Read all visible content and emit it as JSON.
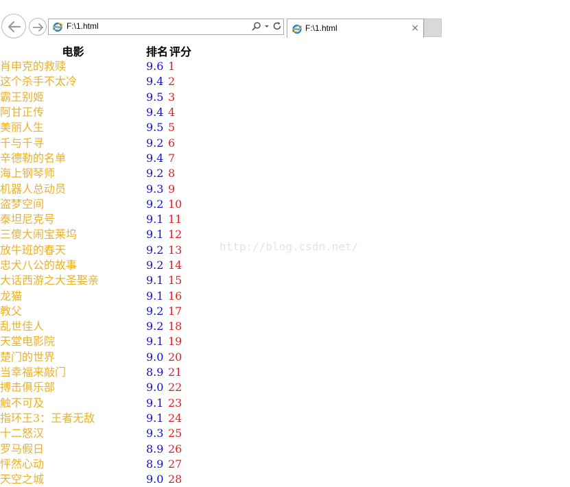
{
  "browser": {
    "address": "F:\\1.html",
    "tab_title": "F:\\1.html",
    "tab_close_glyph": "×",
    "icons": [
      "back-arrow-icon",
      "forward-arrow-icon",
      "ie-icon",
      "search-icon",
      "dropdown-icon",
      "refresh-icon",
      "close-icon"
    ]
  },
  "table": {
    "headers": [
      "电影",
      "排名",
      "评分"
    ],
    "rows": [
      {
        "title": "肖申克的救赎",
        "score": "9.6",
        "rank": "1"
      },
      {
        "title": "这个杀手不太冷",
        "score": "9.4",
        "rank": "2"
      },
      {
        "title": "霸王别姬",
        "score": "9.5",
        "rank": "3"
      },
      {
        "title": "阿甘正传",
        "score": "9.4",
        "rank": "4"
      },
      {
        "title": "美丽人生",
        "score": "9.5",
        "rank": "5"
      },
      {
        "title": "千与千寻",
        "score": "9.2",
        "rank": "6"
      },
      {
        "title": "辛德勒的名单",
        "score": "9.4",
        "rank": "7"
      },
      {
        "title": "海上钢琴师",
        "score": "9.2",
        "rank": "8"
      },
      {
        "title": "机器人总动员",
        "score": "9.3",
        "rank": "9"
      },
      {
        "title": "盗梦空间",
        "score": "9.2",
        "rank": "10"
      },
      {
        "title": "泰坦尼克号",
        "score": "9.1",
        "rank": "11"
      },
      {
        "title": "三傻大闹宝莱坞",
        "score": "9.1",
        "rank": "12"
      },
      {
        "title": "放牛班的春天",
        "score": "9.2",
        "rank": "13"
      },
      {
        "title": "忠犬八公的故事",
        "score": "9.2",
        "rank": "14"
      },
      {
        "title": "大话西游之大圣娶亲",
        "score": "9.1",
        "rank": "15"
      },
      {
        "title": "龙猫",
        "score": "9.1",
        "rank": "16"
      },
      {
        "title": "教父",
        "score": "9.2",
        "rank": "17"
      },
      {
        "title": "乱世佳人",
        "score": "9.2",
        "rank": "18"
      },
      {
        "title": "天堂电影院",
        "score": "9.1",
        "rank": "19"
      },
      {
        "title": "楚门的世界",
        "score": "9.0",
        "rank": "20"
      },
      {
        "title": "当幸福来敲门",
        "score": "8.9",
        "rank": "21"
      },
      {
        "title": "搏击俱乐部",
        "score": "9.0",
        "rank": "22"
      },
      {
        "title": "触不可及",
        "score": "9.1",
        "rank": "23"
      },
      {
        "title": "指环王3：王者无敌",
        "score": "9.1",
        "rank": "24"
      },
      {
        "title": "十二怒汉",
        "score": "9.3",
        "rank": "25"
      },
      {
        "title": "罗马假日",
        "score": "8.9",
        "rank": "26"
      },
      {
        "title": "怦然心动",
        "score": "8.9",
        "rank": "27"
      },
      {
        "title": "天空之城",
        "score": "9.0",
        "rank": "28"
      }
    ]
  },
  "watermark": "http://blog.csdn.net/",
  "colors": {
    "title_text": "#e8b12a",
    "score_text": "#1010d0",
    "rank_text": "#e02020",
    "header_text": "#000000",
    "watermark": "#e3e3e3"
  }
}
